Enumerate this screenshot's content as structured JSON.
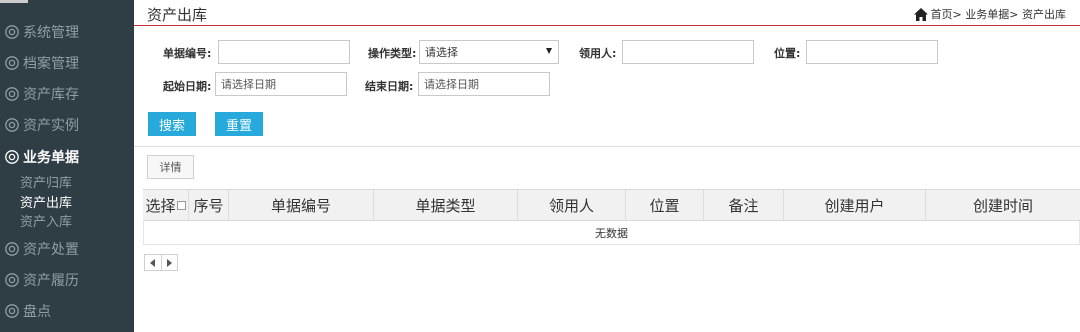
{
  "sidebar": {
    "items": [
      {
        "label": "系统管理"
      },
      {
        "label": "档案管理"
      },
      {
        "label": "资产库存"
      },
      {
        "label": "资产实例"
      },
      {
        "label": "业务单据"
      },
      {
        "label": "资产处置"
      },
      {
        "label": "资产履历"
      },
      {
        "label": "盘点"
      }
    ],
    "subitems": [
      {
        "label": "资产归库"
      },
      {
        "label": "资产出库"
      },
      {
        "label": "资产入库"
      }
    ]
  },
  "header": {
    "title": "资产出库",
    "breadcrumb": "首页> 业务单据> 资产出库"
  },
  "filters": {
    "doc_no": {
      "label": "单据编号:",
      "value": ""
    },
    "op_type": {
      "label": "操作类型:",
      "selected": "请选择"
    },
    "recipient": {
      "label": "领用人:",
      "value": ""
    },
    "location": {
      "label": "位置:",
      "value": ""
    },
    "start_date": {
      "label": "起始日期:",
      "placeholder": "请选择日期"
    },
    "end_date": {
      "label": "结束日期:",
      "placeholder": "请选择日期"
    }
  },
  "buttons": {
    "search": "搜索",
    "reset": "重置",
    "detail": "详情"
  },
  "table": {
    "columns": [
      "选择",
      "序号",
      "单据编号",
      "单据类型",
      "领用人",
      "位置",
      "备注",
      "创建用户",
      "创建时间"
    ],
    "empty_text": "无数据"
  },
  "colors": {
    "sidebar_bg": "#2f3e44",
    "accent_blue": "#27a9dc",
    "header_line": "#c8323c"
  }
}
